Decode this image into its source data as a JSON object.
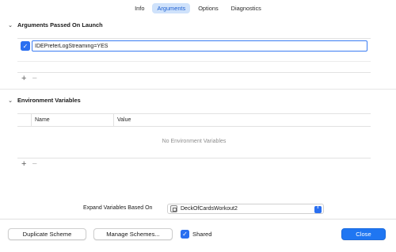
{
  "tabs": [
    {
      "label": "Info",
      "active": false
    },
    {
      "label": "Arguments",
      "active": true
    },
    {
      "label": "Options",
      "active": false
    },
    {
      "label": "Diagnostics",
      "active": false
    }
  ],
  "arguments_section": {
    "title": "Arguments Passed On Launch",
    "items": [
      {
        "value": "IDEPreferLogStreaming=YES",
        "checked": true
      }
    ]
  },
  "environment_section": {
    "title": "Environment Variables",
    "columns": [
      "Name",
      "Value"
    ],
    "empty_text": "No Environment Variables"
  },
  "expand_variables": {
    "label": "Expand Variables Based On",
    "selected": "DeckOfCardsWorkout2"
  },
  "footer": {
    "duplicate_label": "Duplicate Scheme",
    "manage_label": "Manage Schemes...",
    "shared_label": "Shared",
    "shared_checked": true,
    "close_label": "Close"
  },
  "colors": {
    "accent": "#2a6ff0",
    "close_button": "#1f76f2",
    "active_tab_bg": "#cfe2fb"
  },
  "icons": {
    "plus": "+",
    "minus": "−",
    "check": "✓",
    "disclosure": "⌄",
    "popup_arrows": "⇕"
  }
}
